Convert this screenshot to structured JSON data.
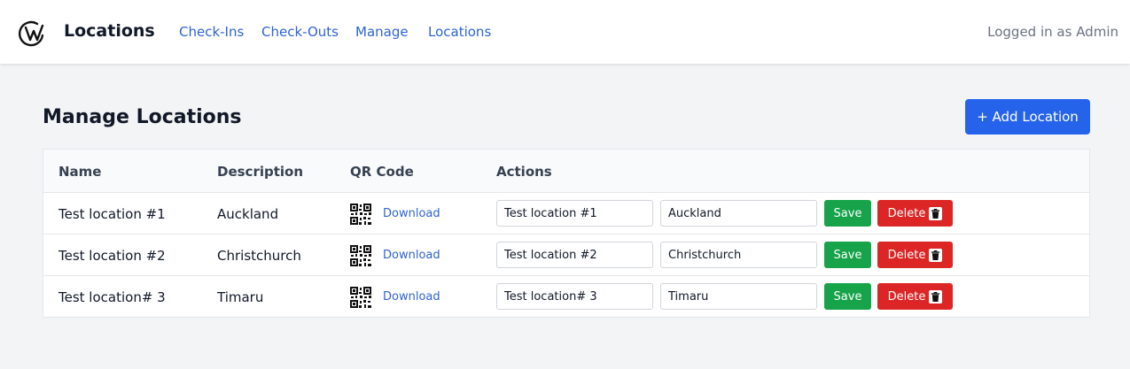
{
  "header": {
    "brand": "Locations",
    "nav": [
      "Check-Ins",
      "Check-Outs",
      "Manage",
      "Locations"
    ],
    "login_text": "Logged in as Admin"
  },
  "main": {
    "title": "Manage Locations",
    "add_button": "+ Add Location"
  },
  "table": {
    "columns": [
      "Name",
      "Description",
      "QR Code",
      "Actions"
    ],
    "rows": [
      {
        "name": "Test location #1",
        "description": "Auckland",
        "qr_link": "Download",
        "name_value": "Test location #1",
        "desc_value": "Auckland",
        "save": "Save",
        "delete": "Delete"
      },
      {
        "name": "Test location #2",
        "description": "Christchurch",
        "qr_link": "Download",
        "name_value": "Test location #2",
        "desc_value": "Christchurch",
        "save": "Save",
        "delete": "Delete"
      },
      {
        "name": "Test location# 3",
        "description": "Timaru",
        "qr_link": "Download",
        "name_value": "Test location# 3",
        "desc_value": "Timaru",
        "save": "Save",
        "delete": "Delete"
      }
    ]
  },
  "icons": {
    "logo": "logo-icon",
    "qr": "qr-code-icon",
    "trash": "trash-icon"
  },
  "colors": {
    "primary": "#2563eb",
    "link": "#2f63d6",
    "save": "#16a34a",
    "delete": "#dc2626",
    "background": "#f3f4f6"
  }
}
